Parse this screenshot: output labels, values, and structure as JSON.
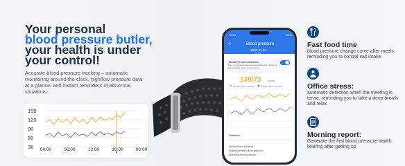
{
  "hero": {
    "line1": "Your personal",
    "line2": "blood pressure butler,",
    "line3": "your health is under",
    "line4": "your control!",
    "description": "Accurate blood pressure tracking – automatic monitoring around the clock, high/low pressure data at a glance, and instant reminders of abnormal situations"
  },
  "chart_data": {
    "type": "line",
    "x": [
      "00:00",
      "06:00",
      "12:00",
      "18:00",
      "00:00"
    ],
    "ylim": [
      30,
      150
    ],
    "yticks": [
      150,
      120,
      90,
      60,
      30
    ],
    "series": [
      {
        "color": "#f2b233",
        "values": [
          112,
          120,
          104,
          124,
          111,
          122,
          108,
          126,
          110,
          121,
          106,
          128,
          112,
          130,
          118,
          125,
          121,
          136,
          127,
          145
        ]
      },
      {
        "color": "#7a6ee8",
        "values": [
          68,
          74,
          62,
          79,
          66,
          73,
          60,
          77,
          67,
          72,
          64,
          78,
          66,
          80,
          70,
          76,
          68,
          80,
          72,
          82
        ]
      }
    ],
    "marker_color": "#f2b233"
  },
  "phone": {
    "status_time": "10:14",
    "status_right": "5G ■",
    "back": "<",
    "title": "Blood pressure",
    "date": "2020-07-01",
    "subdate": "08:00",
    "detection_label": "Blood Pressure Detection",
    "detection_desc": "Turn on the timed blood pressure detection device to automatically detect the blood pre...",
    "reading": "138/73",
    "reading_unit": "mmHg",
    "legend_high": "Systolic blood pressure",
    "legend_low": "Diastolic blood pressure",
    "stat_label": "Statistics",
    "row1": "Normal blood pressure",
    "row2": "Slightly elevated blood pressure",
    "row3": "Abnormal blood pressure"
  },
  "features": [
    {
      "icon": "fork-knife-icon",
      "title": "Fast food time",
      "text": "blood pressure change curve after meals, reminding you to control salt intake"
    },
    {
      "icon": "office-worker-icon",
      "title": "Office stress:",
      "text": "automatic detection when the meeting is tense, reminding you to take a deep breath and relax"
    },
    {
      "icon": "report-icon",
      "title": "Morning report:",
      "text": "Generate the first blood pressure health briefing after getting up"
    }
  ],
  "colors": {
    "accent": "#1a73e8",
    "dark_blue": "#14467e",
    "band_black": "#2a2b2e",
    "screen_green": "#41d04a"
  }
}
